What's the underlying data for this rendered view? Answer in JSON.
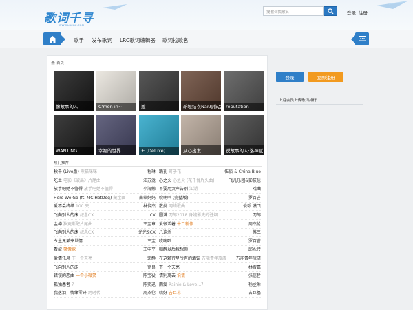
{
  "header": {
    "logo": "歌词千寻",
    "logo_sub": "WWW.LRCGC.COM",
    "search_placeholder": "搜歌词找歌名",
    "login": "登录",
    "register": "注册"
  },
  "nav": {
    "items": [
      "歌手",
      "发布歌词",
      "LRC歌词编辑器",
      "歌词找歌名"
    ]
  },
  "breadcrumb": "首页",
  "albums": [
    {
      "title": "像故事的人",
      "bg": "#1a1a1a"
    },
    {
      "title": "C'mon in~",
      "bg": "#e8e4dc"
    },
    {
      "title": "渡",
      "bg": "#3a3a3a"
    },
    {
      "title": "新垣结衣Nar写作品：跳舞的笑节",
      "bg": "#6a4a3a"
    },
    {
      "title": "reputation",
      "bg": "#555555"
    },
    {
      "title": "WANTING",
      "bg": "#1c1c1c"
    },
    {
      "title": "幸福的世界",
      "bg": "#4a4a6a"
    },
    {
      "title": "+ (Deluxe)",
      "bg": "#2aa6c8"
    },
    {
      "title": "从心出发",
      "bg": "#b8a89a"
    },
    {
      "title": "说故事的人·洛神赋",
      "bg": "#444444"
    }
  ],
  "hot_section": "热门推荐",
  "songs_left": [
    {
      "name": "秋千 (Live版)",
      "sub": "熊猫咪咪",
      "artist": "程琳",
      "hl": false
    },
    {
      "name": "吃土",
      "sub": "电影《破局》片尾曲",
      "artist": "汪苏泷",
      "hl": false
    },
    {
      "name": "放手吧她不值得",
      "sub": "放手吧她不值得",
      "artist": "小海鲸",
      "hl": false
    },
    {
      "name": "Here We Go (ft. MC HotDog)",
      "sub": "藏宝图",
      "artist": "南拳妈妈",
      "hl": false
    },
    {
      "name": "爱不会终结",
      "sub": "100 天",
      "artist": "林俊杰",
      "hl": false
    },
    {
      "name": "飞向别人的床",
      "sub": "纪念CX",
      "artist": "CX",
      "hl": false
    },
    {
      "name": "金樽",
      "sub": "狄更斯配片尾曲",
      "artist": "王至章",
      "hl": false
    },
    {
      "name": "飞向别人的床",
      "sub": "纪念CX",
      "artist": "光光&CX",
      "hl": false
    },
    {
      "name": "今生兄弟来世情",
      "sub": "",
      "artist": "三宝",
      "hl": false
    },
    {
      "name": "看破",
      "sub": "笑傲歌",
      "artist": "王中平",
      "hl": true
    },
    {
      "name": "爱情讯息",
      "sub": "下一个天亮",
      "artist": "郭静",
      "hl": false
    },
    {
      "name": "飞向别人的床",
      "sub": "",
      "artist": "徐良",
      "hl": false
    },
    {
      "name": "错误的恋曲",
      "sub": "一个小微笑",
      "artist": "陈宝役",
      "hl": true
    },
    {
      "name": "孤独患者",
      "sub": "？",
      "artist": "陈奕迅",
      "hl": false
    },
    {
      "name": "我落泪，情绪零碎",
      "sub": "跨时代",
      "artist": "周杰伦",
      "hl": false
    }
  ],
  "songs_right": [
    {
      "name": "踊孔",
      "sub": "町子花",
      "artist": "伍佰 & China Blue",
      "hl": false
    },
    {
      "name": "心之火",
      "sub": "心之火 (花千骨片头曲)",
      "artist": "飞儿乐团&彭筱慧",
      "hl": false
    },
    {
      "name": "不要用哭声告别",
      "sub": "江湖",
      "artist": "戏曲",
      "hl": false
    },
    {
      "name": "吹喇叭 (完整版)",
      "sub": "",
      "artist": "罗百吉",
      "hl": false
    },
    {
      "name": "散类",
      "sub": "网络歌曲",
      "artist": "俊毅 漠飞",
      "hl": false
    },
    {
      "name": "圆满",
      "sub": "刀郎2018 身媲影史的驻烟",
      "artist": "刀郎",
      "hl": false
    },
    {
      "name": "爱很活着",
      "sub": "十二新作",
      "artist": "周杰伦",
      "hl": true
    },
    {
      "name": "八连杀",
      "sub": "",
      "artist": "苏三",
      "hl": false
    },
    {
      "name": "吹喇叭",
      "sub": "",
      "artist": "罗百吉",
      "hl": false
    },
    {
      "name": "喝醉以后我想你",
      "sub": "",
      "artist": "邱永传",
      "hl": false
    },
    {
      "name": "在这颗行星所有的酒馆",
      "sub": "万能青年旅店",
      "artist": "万能青年旅店",
      "hl": false
    },
    {
      "name": "下一个天亮",
      "sub": "",
      "artist": "林宥嘉",
      "hl": false
    },
    {
      "name": "请别离去",
      "sub": "说谎",
      "artist": "张信哲",
      "hl": true
    },
    {
      "name": "雨爱",
      "sub": "Rainie & Love…？",
      "artist": "杨丞琳",
      "hl": false
    },
    {
      "name": "晴好",
      "sub": "吉巨幕",
      "artist": "古巨基",
      "hl": true
    }
  ],
  "sidebar": {
    "login_btn": "登录",
    "register_btn": "立即注册",
    "rank_title": "上月会员上传歌词排行"
  },
  "colors": {
    "brand_blue": "#2f7fc8",
    "accent_orange": "#f29a1f",
    "highlight_text": "#e07818"
  }
}
